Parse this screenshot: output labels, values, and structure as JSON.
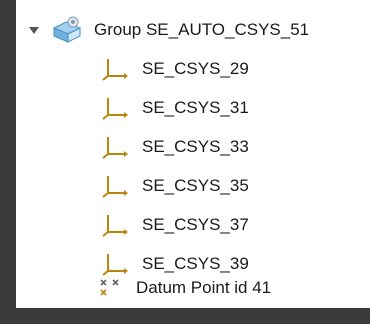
{
  "tree": {
    "group": {
      "label": "Group SE_AUTO_CSYS_51",
      "expanded": true,
      "icon": "group-folder-icon"
    },
    "children": [
      {
        "label": "SE_CSYS_29",
        "icon": "csys-icon"
      },
      {
        "label": "SE_CSYS_31",
        "icon": "csys-icon"
      },
      {
        "label": "SE_CSYS_33",
        "icon": "csys-icon"
      },
      {
        "label": "SE_CSYS_35",
        "icon": "csys-icon"
      },
      {
        "label": "SE_CSYS_37",
        "icon": "csys-icon"
      },
      {
        "label": "SE_CSYS_39",
        "icon": "csys-icon"
      }
    ],
    "point": {
      "label": "Datum Point id 41",
      "icon": "datum-point-icon"
    }
  },
  "colors": {
    "background": "#3b3b3b",
    "panel": "#ffffff",
    "csys_icon": "#b8860b",
    "text": "#1a1a1a"
  }
}
